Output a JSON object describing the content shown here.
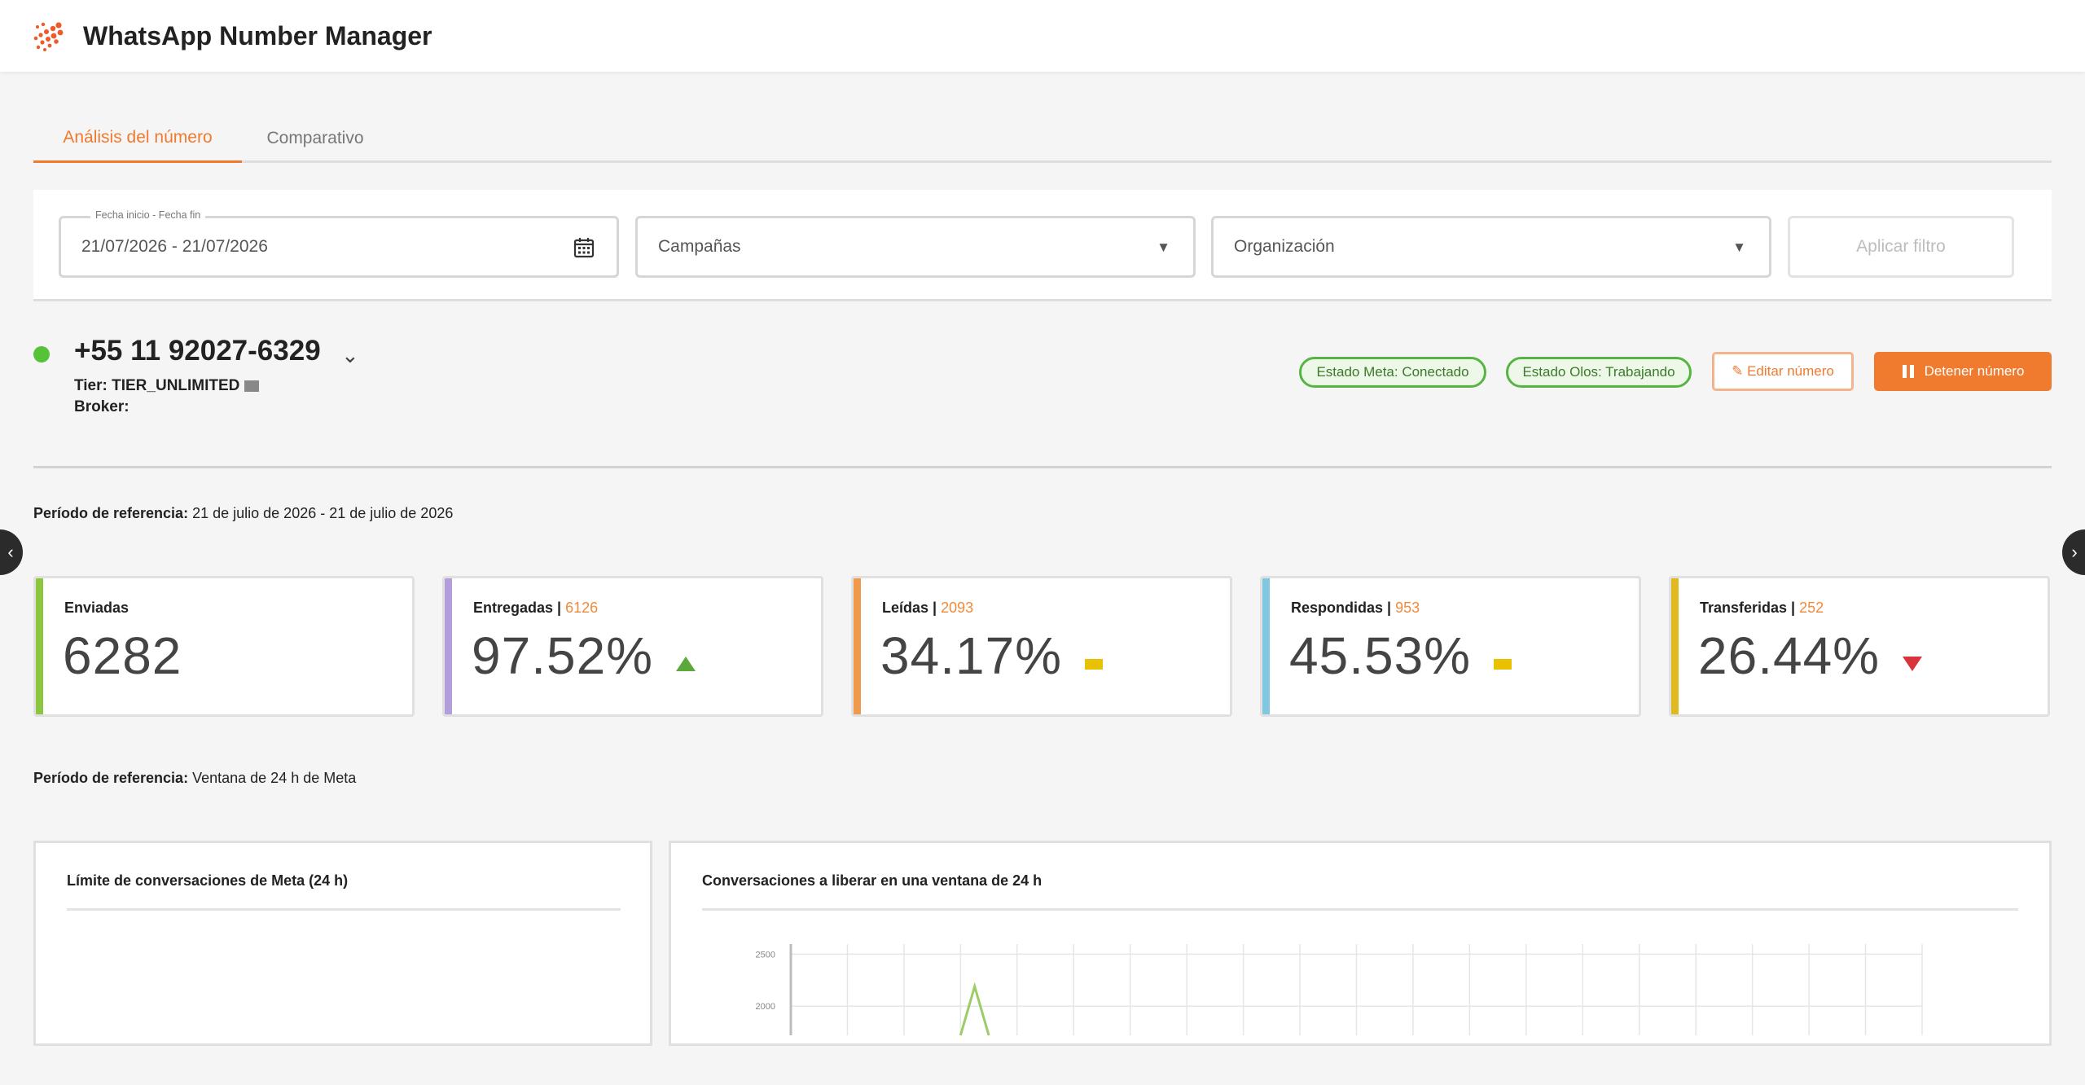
{
  "app": {
    "title": "WhatsApp Number Manager",
    "brand_color": "#f07a2e"
  },
  "tabs": [
    {
      "label": "Análisis del número",
      "active": true
    },
    {
      "label": "Comparativo",
      "active": false
    }
  ],
  "filters": {
    "date_range": {
      "legend": "Fecha inicio - Fecha fin",
      "value": "21/07/2026 - 21/07/2026"
    },
    "campaigns": {
      "value": "Campañas"
    },
    "organization": {
      "value": "Organización"
    },
    "apply_label": "Aplicar filtro"
  },
  "number": {
    "phone": "+55 11 92027-6329",
    "status_color": "#55c237",
    "tier_label": "Tier:",
    "tier_value": "TIER_UNLIMITED",
    "broker_label": "Broker:",
    "broker_value": "",
    "meta_status": "Estado Meta: Conectado",
    "olos_status": "Estado Olos: Trabajando",
    "edit_label": "✎ Editar número",
    "stop_label": "Detener número"
  },
  "period1": {
    "label": "Período de referencia:",
    "value": "21 de julio de 2026 - 21 de julio de 2026"
  },
  "kpis": [
    {
      "title": "Enviadas",
      "count": "",
      "value": "6282",
      "color": "#8cc63f",
      "indicator": "none"
    },
    {
      "title": "Entregadas |",
      "count": "6126",
      "value": "97.52%",
      "color": "#b39ddb",
      "indicator": "up"
    },
    {
      "title": "Leídas |",
      "count": "2093",
      "value": "34.17%",
      "color": "#f0994a",
      "indicator": "neutral"
    },
    {
      "title": "Respondidas |",
      "count": "953",
      "value": "45.53%",
      "color": "#7ec8e3",
      "indicator": "neutral"
    },
    {
      "title": "Transferidas |",
      "count": "252",
      "value": "26.44%",
      "color": "#e0b820",
      "indicator": "down"
    }
  ],
  "period2": {
    "label": "Período de referencia:",
    "value": "Ventana de 24 h de Meta"
  },
  "panels": {
    "limit_title": "Límite de conversaciones de Meta (24 h)",
    "release_title": "Conversaciones a liberar en una ventana de 24 h"
  },
  "chart_data": {
    "type": "line",
    "title": "",
    "y_ticks": [
      "2500",
      "2000"
    ],
    "y_visible_range": [
      1720,
      2550
    ],
    "gridlines": 20,
    "series": [
      {
        "color": "#9ccc65",
        "points": [
          [
            3,
            1720
          ],
          [
            3.25,
            2190
          ],
          [
            3.5,
            1720
          ]
        ]
      }
    ]
  }
}
